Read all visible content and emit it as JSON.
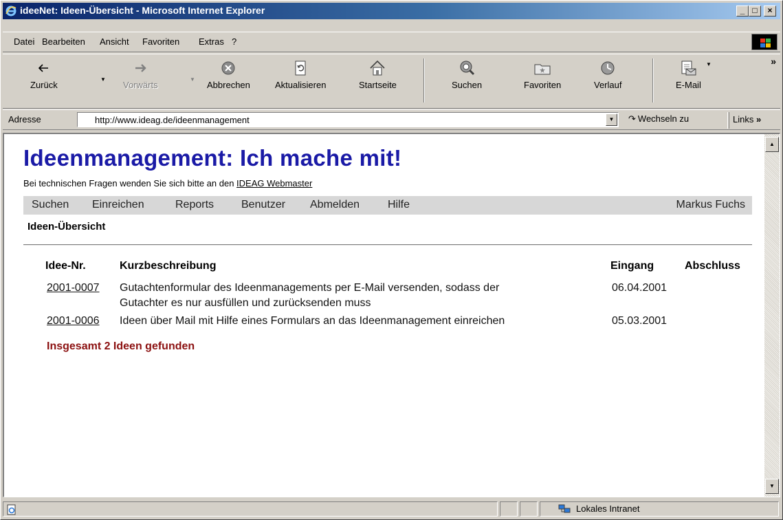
{
  "window": {
    "title": "ideeNet: Ideen-Übersicht - Microsoft Internet Explorer",
    "controls": {
      "minimize": "_",
      "maximize": "□",
      "close": "×"
    }
  },
  "menu": [
    "Datei",
    "Bearbeiten",
    "Ansicht",
    "Favoriten",
    "Extras",
    "?"
  ],
  "toolbar": {
    "back": "Zurück",
    "forward": "Vorwärts",
    "stop": "Abbrechen",
    "refresh": "Aktualisieren",
    "home": "Startseite",
    "search": "Suchen",
    "favorites": "Favoriten",
    "history": "Verlauf",
    "mail": "E-Mail",
    "more": "»"
  },
  "address": {
    "label": "Adresse",
    "url": "http://www.ideag.de/ideenmanagement",
    "go": "Wechseln zu",
    "links": "Links",
    "links_more": "»"
  },
  "page": {
    "title": "Ideenmanagement: Ich mache mit!",
    "subtitle_prefix": "Bei technischen Fragen wenden Sie sich bitte an den ",
    "webmaster_link": "IDEAG Webmaster",
    "nav": [
      "Suchen",
      "Einreichen",
      "Reports",
      "Benutzer",
      "Abmelden",
      "Hilfe"
    ],
    "user": "Markus Fuchs",
    "section_title": "Ideen-Übersicht",
    "table": {
      "headers": {
        "id": "Idee-Nr.",
        "desc": "Kurzbeschreibung",
        "received": "Eingang",
        "closed": "Abschluss"
      },
      "rows": [
        {
          "id": "2001-0007",
          "desc_line1": "Gutachtenformular des Ideenmanagements per E-Mail versenden, sodass der",
          "desc_line2": "Gutachter es nur ausfüllen und zurücksenden muss",
          "received": "06.04.2001",
          "closed": ""
        },
        {
          "id": "2001-0006",
          "desc_line1": "Ideen über Mail mit Hilfe eines Formulars an das Ideenmanagement einreichen",
          "desc_line2": "",
          "received": "05.03.2001",
          "closed": ""
        }
      ]
    },
    "result_text": "Insgesamt 2 Ideen gefunden"
  },
  "status": {
    "zone": "Lokales Intranet"
  },
  "colors": {
    "title_bar": "#0a246a",
    "page_title": "#1a1aa6",
    "result": "#8b1010",
    "nav_bg": "#d7d7d7"
  }
}
